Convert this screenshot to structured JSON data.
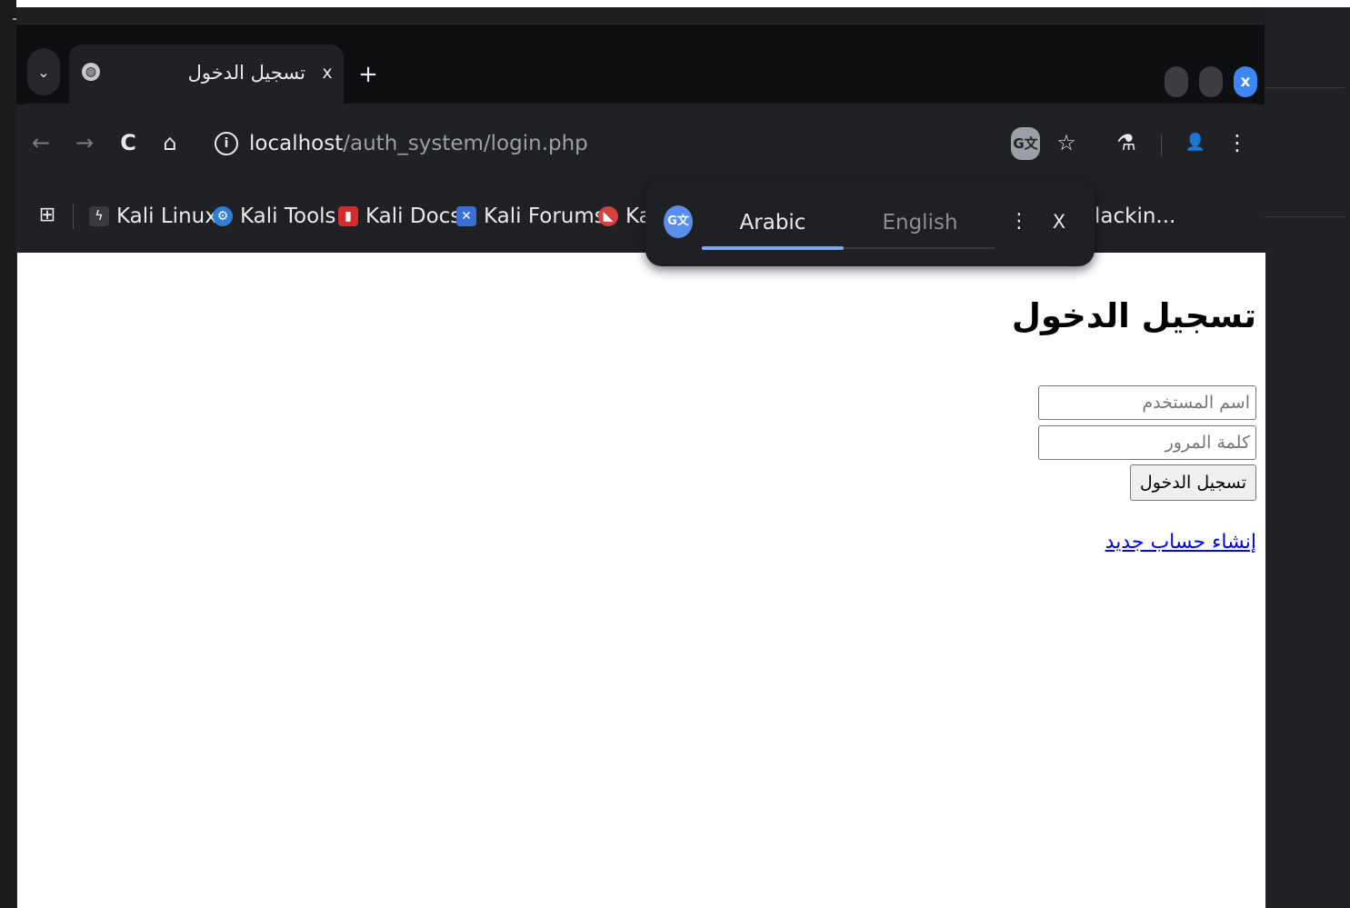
{
  "tab": {
    "title": "تسجيل الدخول",
    "close_label": "x"
  },
  "tabstrip": {
    "tab_search_icon": "chevron-down-icon",
    "new_tab_label": "+"
  },
  "window_controls": {
    "close_label": "x"
  },
  "toolbar": {
    "back_icon": "←",
    "forward_icon": "→",
    "reload_icon": "C",
    "home_icon": "⌂",
    "info_icon": "i",
    "bookmark_icon": "☆",
    "labs_icon": "⚗",
    "profile_icon": "👤",
    "menu_icon": "⋮"
  },
  "address_bar": {
    "host": "localhost",
    "path": "/auth_system/login.php"
  },
  "bookmarks": {
    "apps_icon": "⊞",
    "items": [
      {
        "label": "Kali Linux",
        "icon": "kali-dragon-icon",
        "color": "#3b3b3b"
      },
      {
        "label": "Kali Tools",
        "icon": "kali-tools-icon",
        "color": "#2f7fd6"
      },
      {
        "label": "Kali Docs",
        "icon": "kali-docs-icon",
        "color": "#d42d2d"
      },
      {
        "label": "Kali Forums",
        "icon": "kali-forums-icon",
        "color": "#3b6fd4"
      },
      {
        "label": "Ka",
        "icon": "kali-nethunter-icon",
        "color": "#d94040"
      }
    ],
    "truncated_tail": "lackin..."
  },
  "translate_popup": {
    "active_language": "Arabic",
    "other_language": "English",
    "menu_icon": "⋮",
    "close_label": "X",
    "accent_color": "#7fa7f0"
  },
  "page": {
    "heading": "تسجيل الدخول",
    "username_placeholder": "اسم المستخدم",
    "password_placeholder": "كلمة المرور",
    "submit_label": "تسجيل الدخول",
    "signup_link": "إنشاء حساب جديد",
    "link_color": "#0000ee"
  }
}
